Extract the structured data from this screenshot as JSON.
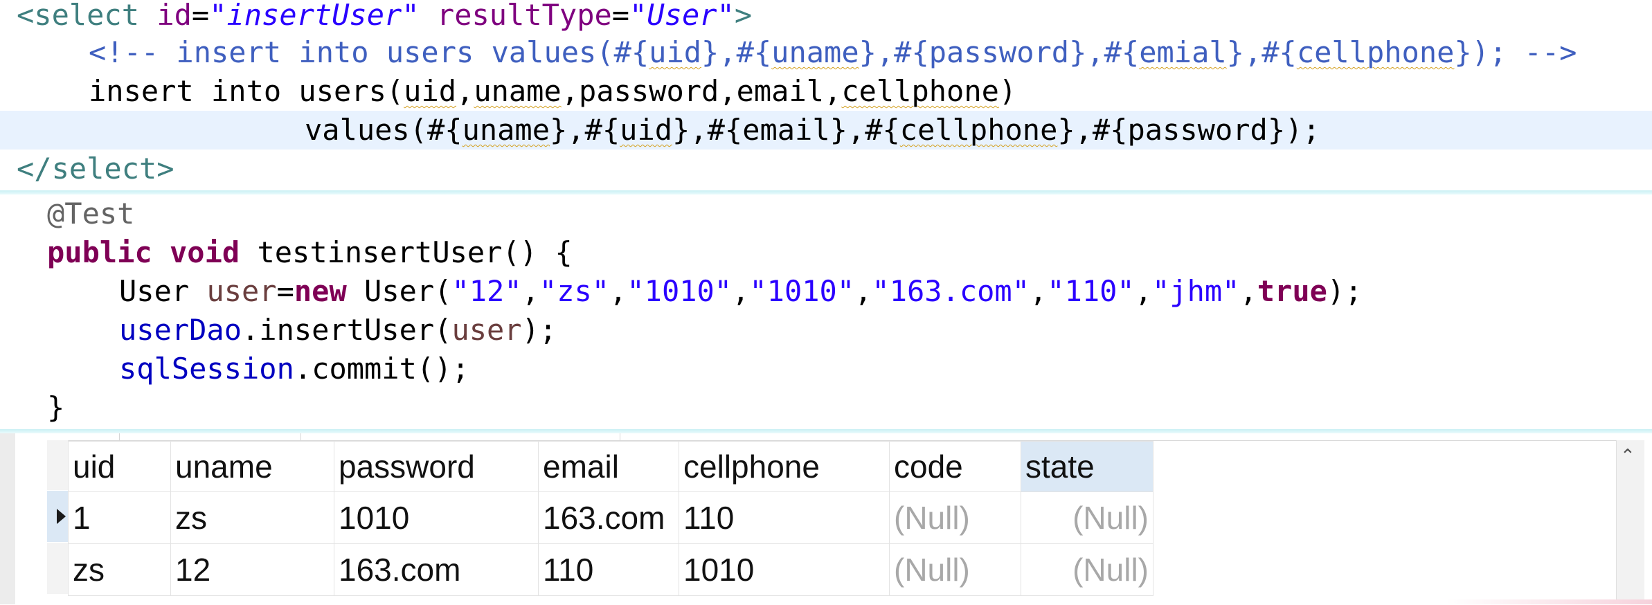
{
  "xml_mapper": {
    "select_open": {
      "tag_start": "<select",
      "id_attr": "id",
      "id_value": "\"insertUser\"",
      "result_attr": "resultType",
      "result_value": "\"User\"",
      "tag_end": ">"
    },
    "comment_line": {
      "open": "<!-- insert into users values(#{",
      "p1": "uid",
      "s1": "},#{",
      "p2": "uname",
      "s2": "},#{",
      "p3": "password",
      "s3": "},#{",
      "p4": "emial",
      "s4": "},#{",
      "p5": "cellphone",
      "close": "}); -->"
    },
    "insert_line": {
      "pre": "insert into users(",
      "c1": "uid",
      "s1": ",",
      "c2": "uname",
      "s2": ",password,email,",
      "c3": "cellphone",
      "post": ")"
    },
    "values_line": {
      "pre": "values(#{",
      "v1": "uname",
      "s1": "},#{",
      "v2": "uid",
      "s2": "},#{",
      "v3": "email",
      "s3": "},#{",
      "v4": "cellphone",
      "s4": "},#{",
      "v5": "password",
      "post": "});"
    },
    "select_close": "</select>"
  },
  "java_test": {
    "annotation": "@Test",
    "kw_public": "public",
    "kw_void": "void",
    "method_sig": " testinsertUser() {",
    "line1": {
      "type": "User ",
      "var": "user",
      "eq": "=",
      "kw_new": "new",
      "ctor": " User(",
      "a1": "\"12\"",
      "c1": ",",
      "a2": "\"zs\"",
      "c2": ",",
      "a3": "\"1010\"",
      "c3": ",",
      "a4": "\"1010\"",
      "c4": ",",
      "a5": "\"163.com\"",
      "c5": ",",
      "a6": "\"110\"",
      "c6": ",",
      "a7": "\"jhm\"",
      "c7": ",",
      "kw_true": "true",
      "end": ");"
    },
    "line2": {
      "field": "userDao",
      "call": ".insertUser(",
      "arg": "user",
      "end": ");"
    },
    "line3": {
      "field": "sqlSession",
      "call": ".commit();"
    },
    "close_brace": "}"
  },
  "result_grid": {
    "columns": [
      "uid",
      "uname",
      "password",
      "email",
      "cellphone",
      "code",
      "state"
    ],
    "active_column": "state",
    "rows": [
      {
        "selected": true,
        "cells": [
          "1",
          "zs",
          "1010",
          "163.com",
          "110",
          "(Null)",
          "(Null)"
        ]
      },
      {
        "selected": false,
        "cells": [
          "zs",
          "12",
          "163.com",
          "110",
          "1010",
          "(Null)",
          "(Null)"
        ]
      }
    ],
    "scroll_up_glyph": "⌃",
    "row_pointer_icon": "row-pointer-icon"
  },
  "colors": {
    "xml_tag": "#3f7f7f",
    "xml_attr": "#7f007f",
    "xml_value": "#2a00ff",
    "comment": "#3f5fbf",
    "java_keyword": "#7f0055",
    "java_string": "#2a00ff",
    "java_field": "#0000c0",
    "current_line": "#e8f2fe",
    "active_header": "#dbe8f5",
    "null_text": "#a8a8a8"
  }
}
